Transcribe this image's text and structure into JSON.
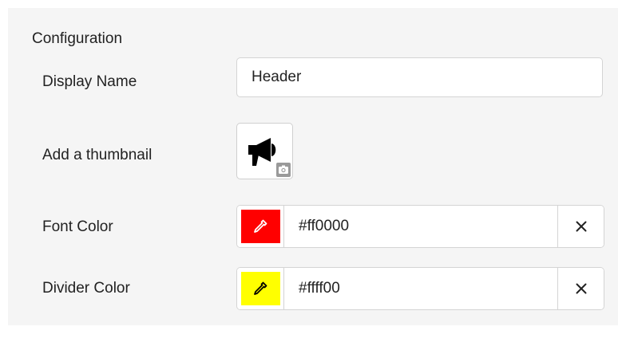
{
  "section": {
    "title": "Configuration"
  },
  "display_name": {
    "label": "Display Name",
    "value": "Header"
  },
  "thumbnail": {
    "label": "Add a thumbnail",
    "icon": "megaphone-icon",
    "badge_icon": "camera-icon"
  },
  "font_color": {
    "label": "Font Color",
    "value": "#ff0000",
    "swatch_color": "#ff0000",
    "picker_icon": "eyedropper-icon",
    "clear_icon": "close-icon"
  },
  "divider_color": {
    "label": "Divider Color",
    "value": "#ffff00",
    "swatch_color": "#ffff00",
    "picker_icon": "eyedropper-icon",
    "clear_icon": "close-icon"
  }
}
